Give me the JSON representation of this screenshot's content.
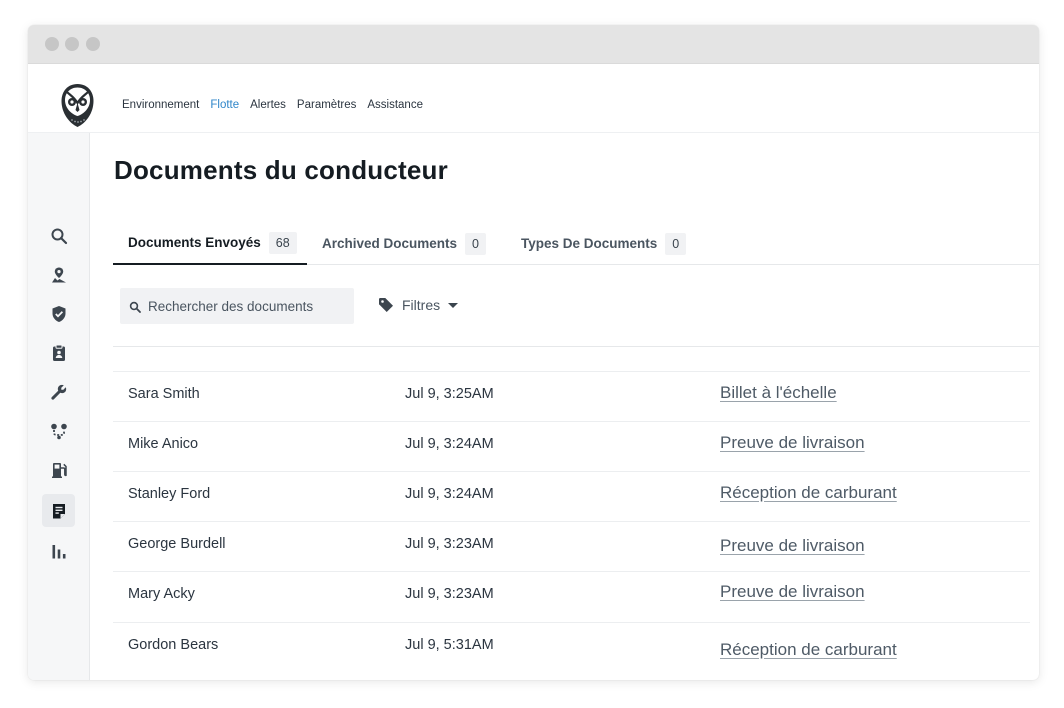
{
  "topnav": {
    "links": [
      {
        "label": "Environnement",
        "active": false
      },
      {
        "label": "Flotte",
        "active": true
      },
      {
        "label": "Alertes",
        "active": false
      },
      {
        "label": "Paramètres",
        "active": false
      },
      {
        "label": "Assistance",
        "active": false
      }
    ]
  },
  "sidebar": {
    "icons": [
      "search-icon",
      "map-pin-icon",
      "shield-check-icon",
      "clipboard-icon",
      "wrench-icon",
      "route-icon",
      "fuel-icon",
      "document-icon",
      "bar-chart-icon"
    ],
    "active_icon": "document-icon"
  },
  "page": {
    "title": "Documents du conducteur"
  },
  "tabs": [
    {
      "label": "Documents Envoyés",
      "count": "68",
      "active": true
    },
    {
      "label": "Archived Documents",
      "count": "0",
      "active": false
    },
    {
      "label": "Types De Documents",
      "count": "0",
      "active": false
    }
  ],
  "search": {
    "placeholder": "Rechercher des documents"
  },
  "filters": {
    "label": "Filtres"
  },
  "documents": [
    {
      "name": "Sara Smith",
      "time": "Jul 9, 3:25AM",
      "type": "Billet à l'échelle"
    },
    {
      "name": "Mike Anico",
      "time": "Jul 9, 3:24AM",
      "type": "Preuve de livraison"
    },
    {
      "name": "Stanley Ford",
      "time": "Jul 9, 3:24AM",
      "type": "Réception de carburant"
    },
    {
      "name": "George Burdell",
      "time": "Jul 9, 3:23AM",
      "type": "Preuve de livraison"
    },
    {
      "name": "Mary Acky",
      "time": "Jul 9, 3:23AM",
      "type": "Preuve de livraison"
    },
    {
      "name": "Gordon Bears",
      "time": "Jul 9, 5:31AM",
      "type": "Réception de carburant"
    }
  ],
  "colors": {
    "accent": "#2f86c9",
    "sidebar_bg": "#f6f7f8",
    "titlebar_bg": "#e4e4e4"
  }
}
